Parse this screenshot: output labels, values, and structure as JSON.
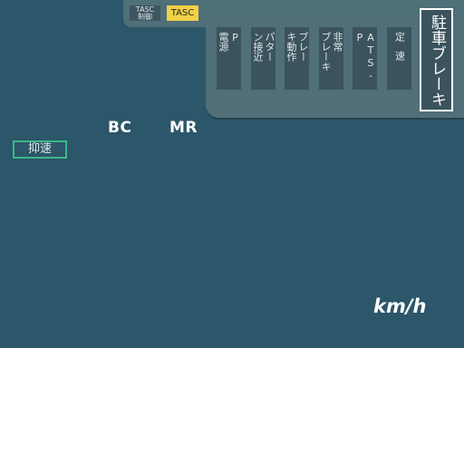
{
  "tasc": {
    "control_label": "TASC\n制御",
    "indicator_label": "TASC",
    "indicator_color": "#f2d147"
  },
  "lamps": [
    {
      "columns": [
        "P",
        "電源"
      ]
    },
    {
      "columns": [
        "パター",
        "ン接近"
      ]
    },
    {
      "columns": [
        "ブレー",
        "キ動作"
      ]
    },
    {
      "columns": [
        "非常",
        "ブレーキ"
      ]
    },
    {
      "columns": [
        "ATS-P"
      ]
    },
    {
      "columns": [
        "定速"
      ]
    }
  ],
  "parking_brake": {
    "label": "駐車ブレーキ"
  },
  "gauges": {
    "bc_label": "BC",
    "mr_label": "MR"
  },
  "yokusoku": {
    "label": "抑速",
    "border_color": "#3cb88a"
  },
  "speed": {
    "unit": "km/h"
  },
  "colors": {
    "background": "#2c5669",
    "panel": "#506f79",
    "lamp_off": "#3b535d"
  }
}
